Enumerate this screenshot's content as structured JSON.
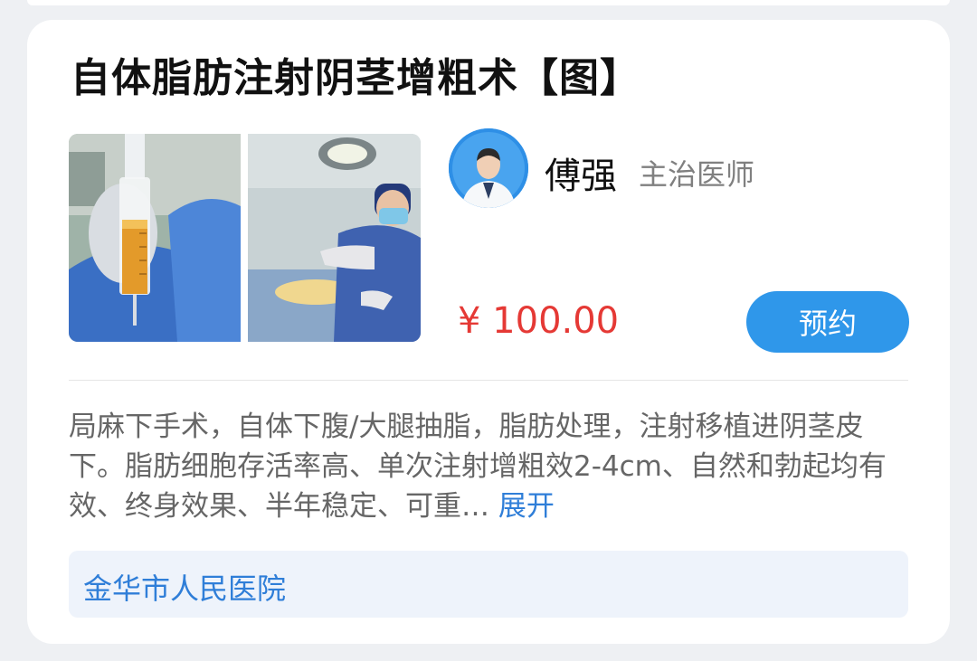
{
  "card": {
    "title": "自体脂肪注射阴茎增粗术【图】",
    "doctor": {
      "name": "傅强",
      "title": "主治医师"
    },
    "price": "¥ 100.00",
    "book_label": "预约",
    "description": "局麻下手术，自体下腹/大腿抽脂，脂肪处理，注射移植进阴茎皮下。脂肪细胞存活率高、单次注射增粗效2-4cm、自然和勃起均有效、终身效果、半年稳定、可重…",
    "expand_label": "展开",
    "hospital": "金华市人民医院"
  },
  "colors": {
    "price": "#e53935",
    "accent": "#2f97ea",
    "link": "#2f7ed8",
    "hospital_bg": "#eef3fb"
  },
  "icons": {
    "avatar": "doctor-portrait",
    "photos": [
      "syringe-photo",
      "surgeon-photo"
    ]
  }
}
